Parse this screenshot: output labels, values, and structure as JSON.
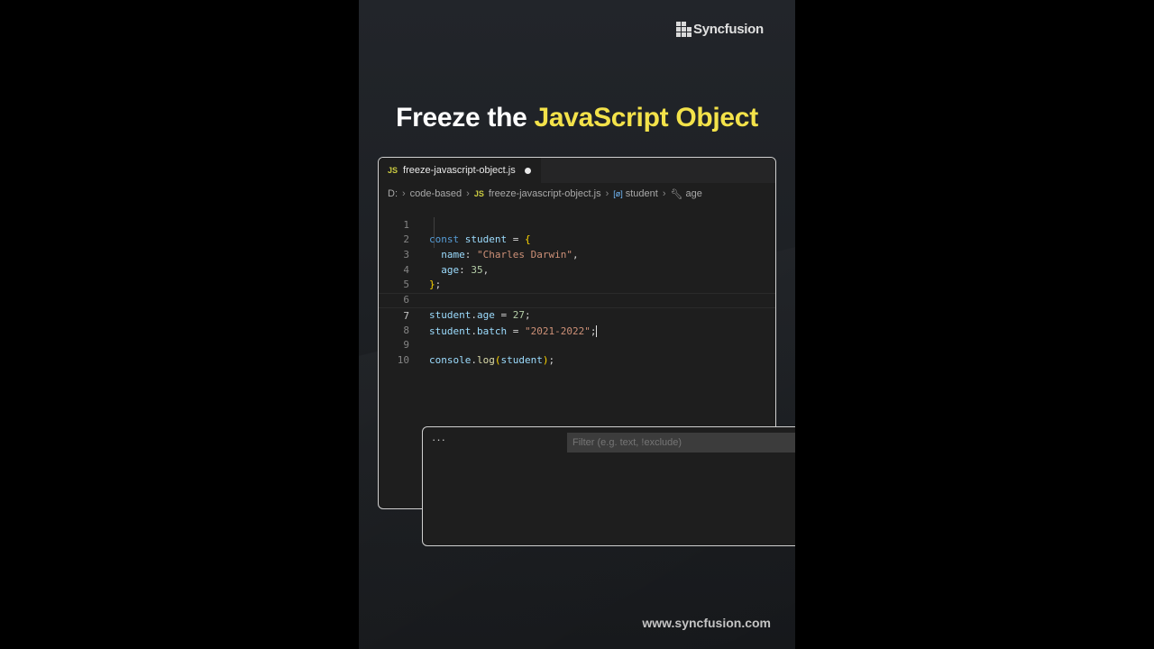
{
  "brand": {
    "name": "Syncfusion",
    "url": "www.syncfusion.com"
  },
  "title": {
    "prefix": "Freeze the ",
    "highlight": "JavaScript Object"
  },
  "editor": {
    "tab": {
      "badge": "JS",
      "filename": "freeze-javascript-object.js"
    },
    "breadcrumb": {
      "drive": "D:",
      "folder": "code-based",
      "file_badge": "JS",
      "file": "freeze-javascript-object.js",
      "symbol_icon": "[ø]",
      "symbol": "student",
      "property": "age"
    },
    "line_numbers": [
      "1",
      "2",
      "3",
      "4",
      "5",
      "6",
      "7",
      "8",
      "9",
      "10"
    ],
    "code": {
      "l1": {
        "kw": "const",
        "var": "student",
        "op": " = ",
        "br": "{"
      },
      "l2": {
        "key": "name",
        "colon": ": ",
        "str": "\"Charles Darwin\"",
        "end": ","
      },
      "l3": {
        "key": "age",
        "colon": ": ",
        "num": "35",
        "end": ","
      },
      "l4": {
        "br": "}",
        "end": ";"
      },
      "l6": {
        "obj": "student",
        "dot": ".",
        "prop": "age",
        "op": " = ",
        "num": "27",
        "end": ";"
      },
      "l7": {
        "obj": "student",
        "dot": ".",
        "prop": "batch",
        "op": " = ",
        "str": "\"2021-2022\"",
        "end": ";"
      },
      "l9": {
        "obj": "console",
        "dot": ".",
        "fn": "log",
        "open": "(",
        "arg": "student",
        "close": ")",
        "end": ";"
      }
    },
    "current_line": "7"
  },
  "terminal": {
    "more": "···",
    "filter_placeholder": "Filter (e.g. text, !exclude)"
  },
  "colors": {
    "highlight": "#f3e24a",
    "keyword": "#569cd6",
    "string": "#ce9178",
    "number": "#b5cea8",
    "bracket": "#ffd700"
  }
}
